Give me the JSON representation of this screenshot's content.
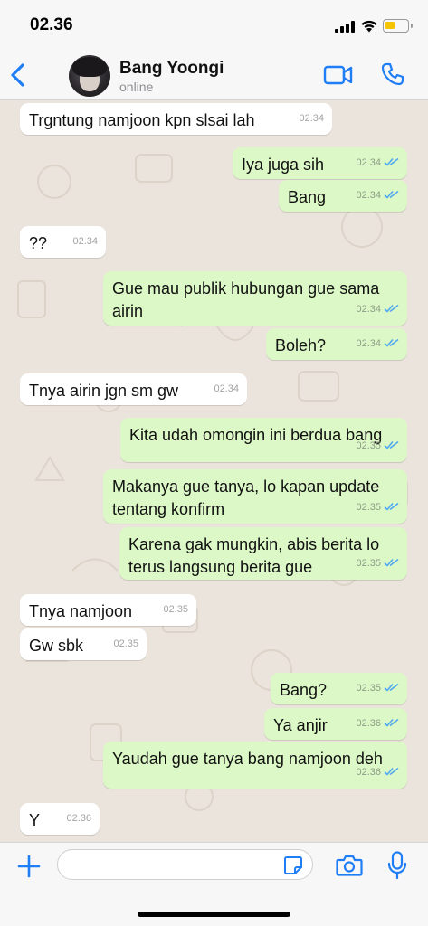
{
  "status_bar": {
    "time": "02.36"
  },
  "header": {
    "name": "Bang Yoongi",
    "status": "online"
  },
  "input": {
    "placeholder": ""
  },
  "theme": {
    "accent": "#1f7ef5",
    "outgoing_bubble": "#dcf8c6",
    "incoming_bubble": "#ffffff",
    "tick_color": "#4fa8f0"
  },
  "messages": [
    {
      "dir": "in",
      "text": "Trgntung namjoon kpn slsai lah",
      "time": "02.34"
    },
    {
      "dir": "out",
      "text": "Iya juga sih",
      "time": "02.34"
    },
    {
      "dir": "out",
      "text": "Bang",
      "time": "02.34"
    },
    {
      "dir": "in",
      "text": "??",
      "time": "02.34"
    },
    {
      "dir": "out",
      "text": "Gue mau publik hubungan gue sama airin",
      "time": "02.34"
    },
    {
      "dir": "out",
      "text": "Boleh?",
      "time": "02.34"
    },
    {
      "dir": "in",
      "text": "Tnya airin jgn sm gw",
      "time": "02.34"
    },
    {
      "dir": "out",
      "text": "Kita udah omongin ini berdua bang",
      "time": "02.35"
    },
    {
      "dir": "out",
      "text": "Makanya gue tanya, lo kapan update tentang konfirm",
      "time": "02.35"
    },
    {
      "dir": "out",
      "text": "Karena gak mungkin, abis berita lo terus langsung berita gue",
      "time": "02.35"
    },
    {
      "dir": "in",
      "text": "Tnya namjoon",
      "time": "02.35"
    },
    {
      "dir": "in",
      "text": "Gw sbk",
      "time": "02.35"
    },
    {
      "dir": "out",
      "text": "Bang?",
      "time": "02.35"
    },
    {
      "dir": "out",
      "text": "Ya anjir",
      "time": "02.36"
    },
    {
      "dir": "out",
      "text": "Yaudah gue tanya bang namjoon deh",
      "time": "02.36"
    },
    {
      "dir": "in",
      "text": "Y",
      "time": "02.36"
    }
  ]
}
